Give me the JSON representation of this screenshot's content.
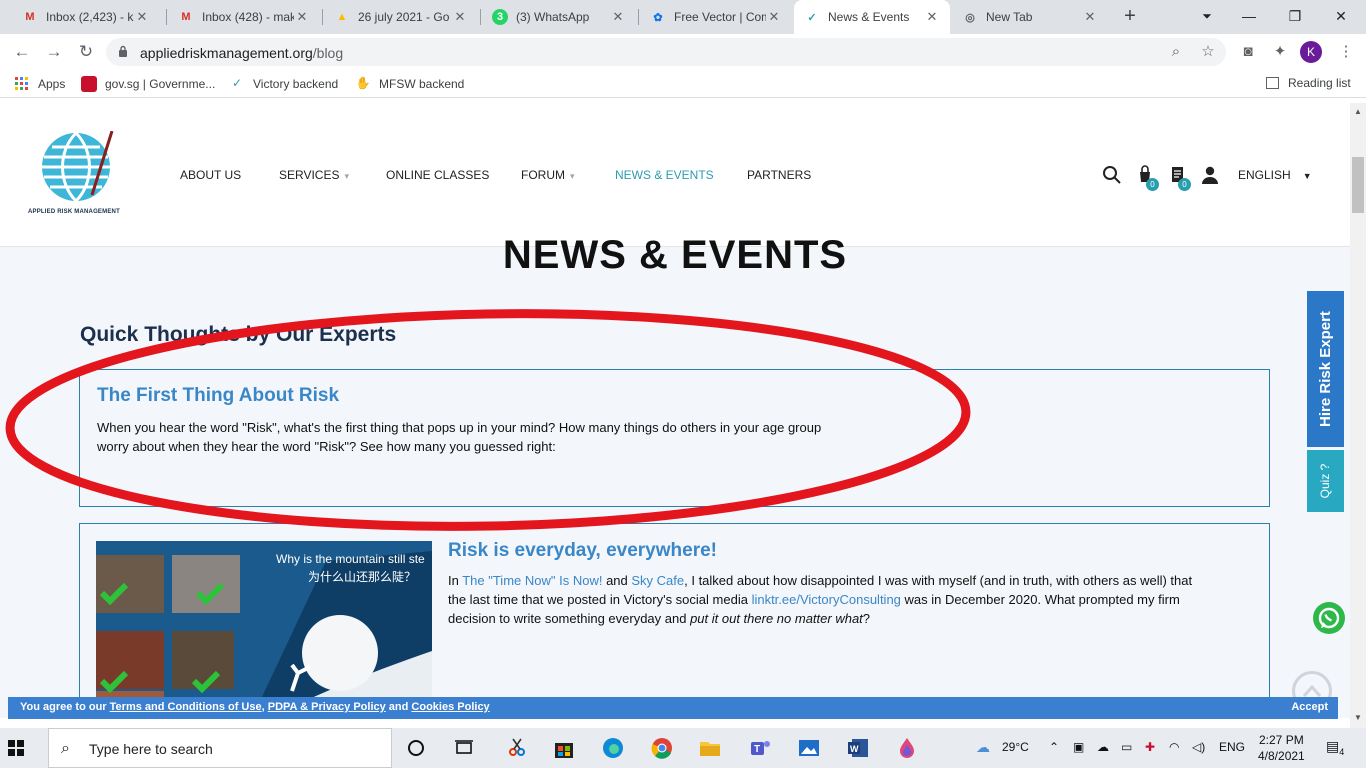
{
  "browser": {
    "tabs": [
      {
        "title": "Inbox (2,423) - ka",
        "icon": "gmail-icon",
        "color": "#d93025",
        "glyph": "M"
      },
      {
        "title": "Inbox (428) - mak",
        "icon": "gmail-icon",
        "color": "#d93025",
        "glyph": "M"
      },
      {
        "title": "26 july 2021 - Go",
        "icon": "drive-icon",
        "color": "#fbbc04",
        "glyph": "▲"
      },
      {
        "title": "(3) WhatsApp",
        "icon": "whatsapp-icon",
        "color": "#25d366",
        "glyph": "3"
      },
      {
        "title": "Free Vector | Com",
        "icon": "freepik-icon",
        "color": "#1273eb",
        "glyph": "✿"
      },
      {
        "title": "News & Events",
        "icon": "site-icon",
        "color": "#2a9db0",
        "glyph": "✓"
      },
      {
        "title": "New Tab",
        "icon": "chrome-icon",
        "color": "#5f6368",
        "glyph": "◎"
      }
    ],
    "new_tab_label": "+",
    "url_domain": "appliedriskmanagement.org",
    "url_path": "/blog",
    "profile_initial": "K",
    "bookmarks": [
      {
        "label": "Apps",
        "icon": "apps-grid-icon"
      },
      {
        "label": "gov.sg | Governme...",
        "icon": "lion-icon"
      },
      {
        "label": "Victory backend",
        "icon": "victory-icon"
      },
      {
        "label": "MFSW backend",
        "icon": "mfsw-icon"
      }
    ],
    "reading_list": "Reading list"
  },
  "site": {
    "logo_text": "APPLIED RISK MANAGEMENT",
    "nav": [
      {
        "label": "ABOUT US",
        "dropdown": false,
        "active": false
      },
      {
        "label": "SERVICES",
        "dropdown": true,
        "active": false
      },
      {
        "label": "ONLINE CLASSES",
        "dropdown": false,
        "active": false
      },
      {
        "label": "FORUM",
        "dropdown": true,
        "active": false
      },
      {
        "label": "NEWS & EVENTS",
        "dropdown": false,
        "active": true
      },
      {
        "label": "PARTNERS",
        "dropdown": false,
        "active": false
      }
    ],
    "cart_count": "0",
    "list_count": "0",
    "language": "ENGLISH",
    "page_title": "NEWS & EVENTS",
    "section_title": "Quick Thoughts by Our Experts",
    "post1": {
      "title": "The First Thing About Risk",
      "body_line1": "When you hear the word \"Risk\", what's the first thing that pops up in your mind? How many things do others in your age group",
      "body_line2": "worry about when they hear the word \"Risk\"? See how many you guessed right:"
    },
    "post2": {
      "title": "Risk is everyday, everywhere!",
      "b1": "In ",
      "link1": "The \"Time Now\" Is Now!",
      "b2": " and ",
      "link2": "Sky Cafe",
      "b3": ", I talked about how disappointed I was with myself (and in truth, with others as well) that",
      "b4": "the last time that we posted in Victory's social media ",
      "link3": "linktr.ee/VictoryConsulting",
      "b5": " was in December 2020. What prompted my firm",
      "b6": "decision to write something everyday and ",
      "italic": "put it out there no matter what",
      "b7": "?",
      "image_caption_en": "Why is the mountain still ste",
      "image_caption_zh": "为什么山还那么陡？"
    },
    "side_tabs": {
      "hire": "Hire Risk Expert",
      "quiz": "Quiz ?"
    },
    "cookie": {
      "prefix": "You agree to our ",
      "terms": "Terms and Conditions of Use",
      "sep1": ", ",
      "privacy": "PDPA & Privacy Policy",
      "sep2": " and ",
      "cookies": "Cookies Policy",
      "accept": "Accept"
    }
  },
  "taskbar": {
    "search_placeholder": "Type here to search",
    "weather": "29°C",
    "lang": "ENG",
    "time": "2:27 PM",
    "date": "4/8/2021",
    "notifications": "4"
  },
  "colors": {
    "accent": "#2a9db0",
    "link": "#3a87c8",
    "annotation": "#e3161e"
  }
}
